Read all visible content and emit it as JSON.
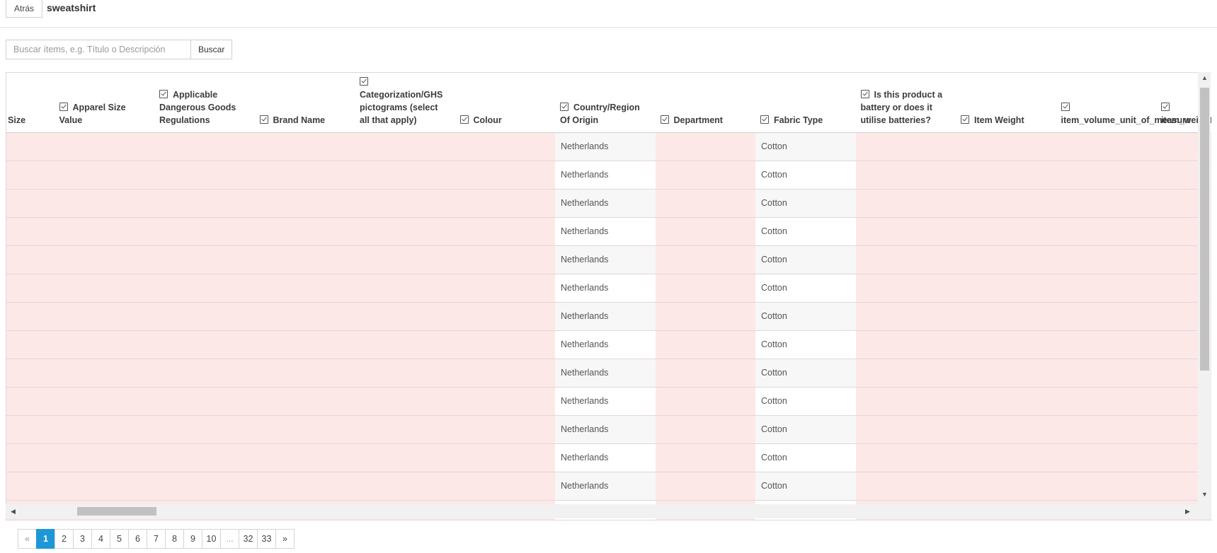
{
  "header": {
    "back_label": "Atrás",
    "title": "sweatshirt"
  },
  "search": {
    "placeholder": "Buscar ítems, e.g. Título o Descripción",
    "button_label": "Buscar"
  },
  "table": {
    "columns": [
      {
        "label": "Apparel Size",
        "checkbox": true
      },
      {
        "label": "Apparel Size Value",
        "checkbox": true
      },
      {
        "label": "Applicable Dangerous Goods Regulations",
        "checkbox": true
      },
      {
        "label": "Brand Name",
        "checkbox": true
      },
      {
        "label": "Categorization/GHS pictograms (select all that apply)",
        "checkbox": true
      },
      {
        "label": "Colour",
        "checkbox": true
      },
      {
        "label": "Country/Region Of Origin",
        "checkbox": true
      },
      {
        "label": "Department",
        "checkbox": true
      },
      {
        "label": "Fabric Type",
        "checkbox": true
      },
      {
        "label": "Is this product a battery or does it utilise batteries?",
        "checkbox": true
      },
      {
        "label": "Item Weight",
        "checkbox": true
      },
      {
        "label": "item_volume_unit_of_measure",
        "checkbox": true
      },
      {
        "label": "item_weight_unit_of_measure",
        "checkbox": true
      }
    ],
    "rows": [
      [
        "",
        "",
        "",
        "",
        "",
        "",
        "Netherlands",
        "",
        "Cotton",
        "",
        "",
        "",
        ""
      ],
      [
        "",
        "",
        "",
        "",
        "",
        "",
        "Netherlands",
        "",
        "Cotton",
        "",
        "",
        "",
        ""
      ],
      [
        "",
        "",
        "",
        "",
        "",
        "",
        "Netherlands",
        "",
        "Cotton",
        "",
        "",
        "",
        ""
      ],
      [
        "",
        "",
        "",
        "",
        "",
        "",
        "Netherlands",
        "",
        "Cotton",
        "",
        "",
        "",
        ""
      ],
      [
        "",
        "",
        "",
        "",
        "",
        "",
        "Netherlands",
        "",
        "Cotton",
        "",
        "",
        "",
        ""
      ],
      [
        "",
        "",
        "",
        "",
        "",
        "",
        "Netherlands",
        "",
        "Cotton",
        "",
        "",
        "",
        ""
      ],
      [
        "",
        "",
        "",
        "",
        "",
        "",
        "Netherlands",
        "",
        "Cotton",
        "",
        "",
        "",
        ""
      ],
      [
        "",
        "",
        "",
        "",
        "",
        "",
        "Netherlands",
        "",
        "Cotton",
        "",
        "",
        "",
        ""
      ],
      [
        "",
        "",
        "",
        "",
        "",
        "",
        "Netherlands",
        "",
        "Cotton",
        "",
        "",
        "",
        ""
      ],
      [
        "",
        "",
        "",
        "",
        "",
        "",
        "Netherlands",
        "",
        "Cotton",
        "",
        "",
        "",
        ""
      ],
      [
        "",
        "",
        "",
        "",
        "",
        "",
        "Netherlands",
        "",
        "Cotton",
        "",
        "",
        "",
        ""
      ],
      [
        "",
        "",
        "",
        "",
        "",
        "",
        "Netherlands",
        "",
        "Cotton",
        "",
        "",
        "",
        ""
      ],
      [
        "",
        "",
        "",
        "",
        "",
        "",
        "Netherlands",
        "",
        "Cotton",
        "",
        "",
        "",
        ""
      ],
      [
        "",
        "",
        "",
        "",
        "",
        "",
        "",
        "",
        "",
        "",
        "",
        "",
        ""
      ]
    ]
  },
  "pagination": {
    "prev": "«",
    "pages": [
      "1",
      "2",
      "3",
      "4",
      "5",
      "6",
      "7",
      "8",
      "9",
      "10",
      "...",
      "32",
      "33"
    ],
    "current": "1",
    "next": "»"
  },
  "colors": {
    "invalid_cell": "#fde8e8",
    "accent": "#1e97d6"
  }
}
